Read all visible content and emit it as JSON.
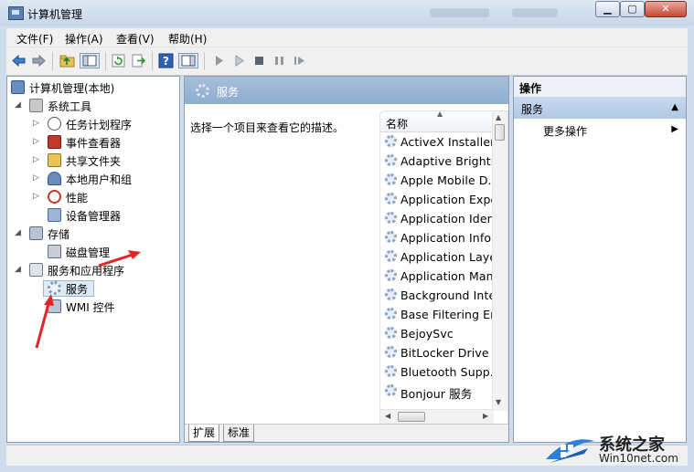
{
  "window": {
    "title": "计算机管理"
  },
  "menubar": {
    "items": [
      "文件(F)",
      "操作(A)",
      "查看(V)",
      "帮助(H)"
    ]
  },
  "toolbar": {
    "buttons": [
      "back-arrow-icon",
      "forward-arrow-icon",
      "up-folder-icon",
      "show-hide-tree-icon",
      "refresh-icon",
      "export-list-icon",
      "help-icon",
      "properties-icon",
      "play-icon",
      "play-outline-icon",
      "stop-icon",
      "pause-icon",
      "restart-icon"
    ]
  },
  "tree": {
    "root": "计算机管理(本地)",
    "system_tools": "系统工具",
    "task_scheduler": "任务计划程序",
    "event_viewer": "事件查看器",
    "shared_folders": "共享文件夹",
    "local_users": "本地用户和组",
    "performance": "性能",
    "device_manager": "设备管理器",
    "storage": "存储",
    "disk_management": "磁盘管理",
    "services_apps": "服务和应用程序",
    "services": "服务",
    "wmi": "WMI 控件"
  },
  "center": {
    "title": "服务",
    "description": "选择一个项目来查看它的描述。",
    "column_name": "名称",
    "services": [
      "ActiveX Installer ...",
      "Adaptive Brightn...",
      "Apple Mobile D...",
      "Application Expe...",
      "Application Iden...",
      "Application Infor...",
      "Application Laye...",
      "Application Man...",
      "Background Inte...",
      "Base Filtering En...",
      "BejoySvc",
      "BitLocker Drive ...",
      "Bluetooth Supp...",
      "Bonjour 服务"
    ],
    "tabs": [
      "扩展",
      "标准"
    ]
  },
  "actions": {
    "header": "操作",
    "section": "服务",
    "more": "更多操作"
  },
  "watermark": {
    "line1": "系统之家",
    "line2": "Win10net.com"
  },
  "colors": {
    "panel_header": "#96b2d2",
    "selection": "#dfeaf7",
    "annotation_arrow": "#e02626"
  }
}
